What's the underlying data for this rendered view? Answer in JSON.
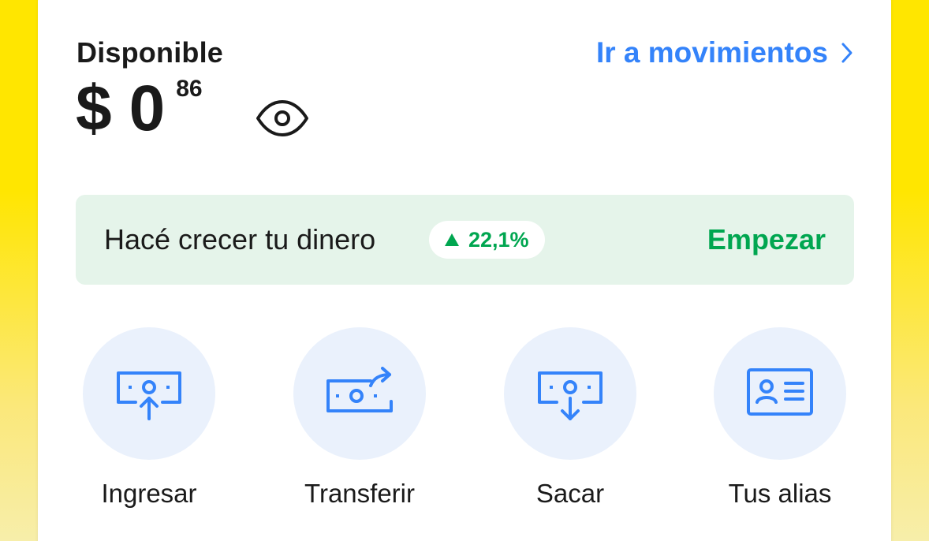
{
  "balance": {
    "label": "Disponible",
    "currency": "$",
    "integer": "0",
    "cents": "86"
  },
  "movements_link": {
    "label": "Ir a movimientos",
    "icon": "chevron-right-icon"
  },
  "promo": {
    "text": "Hacé crecer tu dinero",
    "badge_value": "22,1%",
    "badge_icon": "triangle-up-icon",
    "cta": "Empezar"
  },
  "actions": [
    {
      "label": "Ingresar",
      "icon": "money-in-icon"
    },
    {
      "label": "Transferir",
      "icon": "money-transfer-icon"
    },
    {
      "label": "Sacar",
      "icon": "money-out-icon"
    },
    {
      "label": "Tus alias",
      "icon": "id-card-icon"
    }
  ],
  "colors": {
    "accent_blue": "#3483fa",
    "success_green": "#00a650",
    "promo_bg": "#e5f4ea",
    "action_circle_bg": "#eaf1fc",
    "background_yellow": "#ffe600"
  }
}
